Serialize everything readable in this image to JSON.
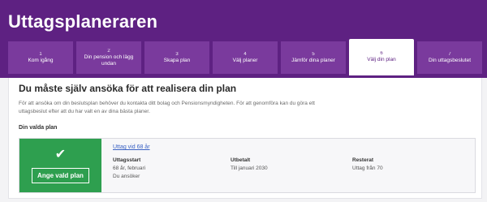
{
  "app": {
    "title": "Uttagsplaneraren"
  },
  "steps": [
    {
      "num": "1",
      "label": "Kom igång",
      "active": false
    },
    {
      "num": "2",
      "label": "Din pension och lägg undan",
      "active": false
    },
    {
      "num": "3",
      "label": "Skapa plan",
      "active": false
    },
    {
      "num": "4",
      "label": "Välj planer",
      "active": false
    },
    {
      "num": "5",
      "label": "Jämför dina planer",
      "active": false
    },
    {
      "num": "6",
      "label": "Välj din plan",
      "active": true
    },
    {
      "num": "7",
      "label": "Din uttagsbeslutet",
      "active": false
    }
  ],
  "panel": {
    "title": "Du måste själv ansöka för att realisera din plan",
    "description": "För att ansöka om din beslutsplan behöver du kontakta ditt bolag och Pensionsmyndigheten. För att genomföra kan du göra ett uttagsbeslut efter att du har valt en av dina bästa planer.",
    "plans_label": "Din valda plan"
  },
  "plan": {
    "select_label": "Ange vald plan",
    "link_text": "Uttag vid 68 år",
    "columns": [
      {
        "label": "Uttagsstart",
        "value": "68 år, februari",
        "value2": "Du ansöker"
      },
      {
        "label": "Utbetalt",
        "value": "Till januari 2030"
      },
      {
        "label": "Resterat",
        "value": "Uttag från 70"
      }
    ]
  },
  "colors": {
    "header": "#5e2182",
    "tab": "#7a3a9d",
    "active_text": "#5e2182",
    "select_button": "#2e9f4f",
    "link": "#3a62c4"
  }
}
